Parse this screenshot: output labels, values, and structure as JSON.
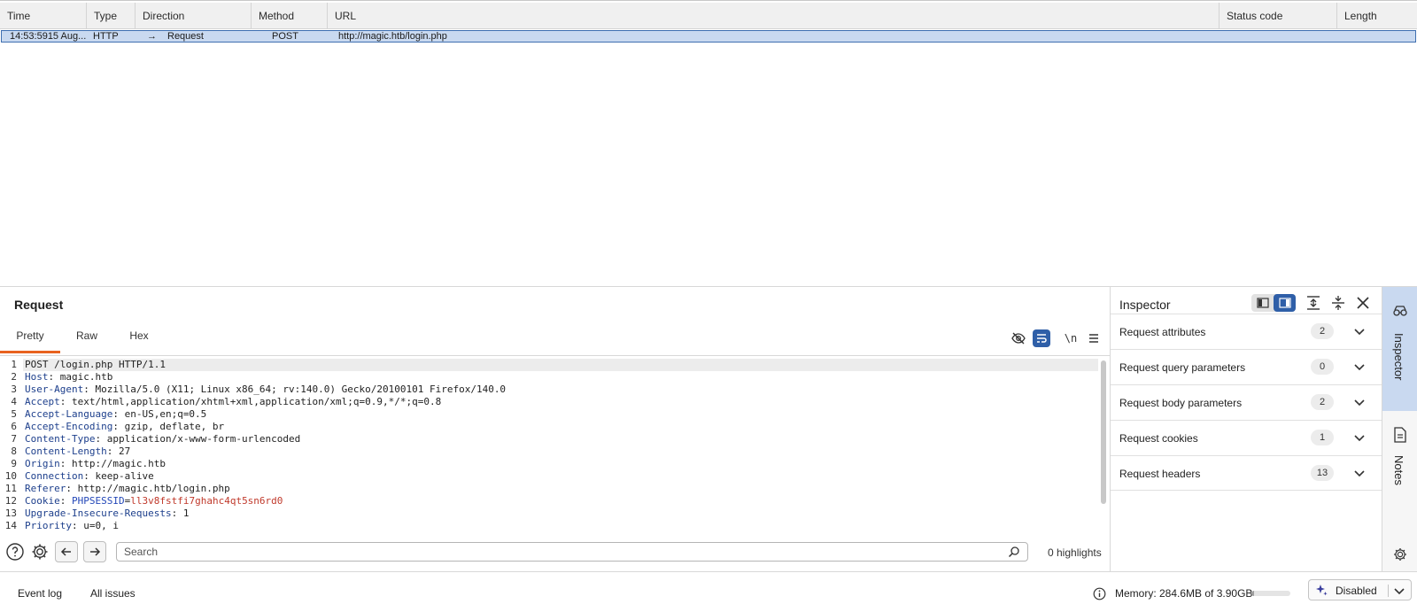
{
  "history": {
    "columns": [
      "Time",
      "Type",
      "Direction",
      "Method",
      "URL",
      "Status code",
      "Length"
    ],
    "rows": [
      {
        "time": "14:53:5915 Aug...",
        "type": "HTTP",
        "direction_arrow": "→",
        "direction": "Request",
        "method": "POST",
        "url": "http://magic.htb/login.php",
        "status": "",
        "length": ""
      }
    ]
  },
  "request": {
    "title": "Request",
    "tabs": [
      "Pretty",
      "Raw",
      "Hex"
    ],
    "active_tab": "Pretty",
    "newline_toggle": "\\n",
    "lines": [
      {
        "n": "1",
        "parts": [
          {
            "t": "POST /login.php HTTP/1.1",
            "c": "plain"
          }
        ]
      },
      {
        "n": "2",
        "parts": [
          {
            "t": "Host",
            "c": "hk"
          },
          {
            "t": ": magic.htb",
            "c": "plain"
          }
        ]
      },
      {
        "n": "3",
        "parts": [
          {
            "t": "User-Agent",
            "c": "hk"
          },
          {
            "t": ": Mozilla/5.0 (X11; Linux x86_64; rv:140.0) Gecko/20100101 Firefox/140.0",
            "c": "plain"
          }
        ]
      },
      {
        "n": "4",
        "parts": [
          {
            "t": "Accept",
            "c": "hk"
          },
          {
            "t": ": text/html,application/xhtml+xml,application/xml;q=0.9,*/*;q=0.8",
            "c": "plain"
          }
        ]
      },
      {
        "n": "5",
        "parts": [
          {
            "t": "Accept-Language",
            "c": "hk"
          },
          {
            "t": ": en-US,en;q=0.5",
            "c": "plain"
          }
        ]
      },
      {
        "n": "6",
        "parts": [
          {
            "t": "Accept-Encoding",
            "c": "hk"
          },
          {
            "t": ": gzip, deflate, br",
            "c": "plain"
          }
        ]
      },
      {
        "n": "7",
        "parts": [
          {
            "t": "Content-Type",
            "c": "hk"
          },
          {
            "t": ": application/x-www-form-urlencoded",
            "c": "plain"
          }
        ]
      },
      {
        "n": "8",
        "parts": [
          {
            "t": "Content-Length",
            "c": "hk"
          },
          {
            "t": ": 27",
            "c": "plain"
          }
        ]
      },
      {
        "n": "9",
        "parts": [
          {
            "t": "Origin",
            "c": "hk"
          },
          {
            "t": ": http://magic.htb",
            "c": "plain"
          }
        ]
      },
      {
        "n": "10",
        "parts": [
          {
            "t": "Connection",
            "c": "hk"
          },
          {
            "t": ": keep-alive",
            "c": "plain"
          }
        ]
      },
      {
        "n": "11",
        "parts": [
          {
            "t": "Referer",
            "c": "hk"
          },
          {
            "t": ": http://magic.htb/login.php",
            "c": "plain"
          }
        ]
      },
      {
        "n": "12",
        "parts": [
          {
            "t": "Cookie",
            "c": "hk"
          },
          {
            "t": ": ",
            "c": "plain"
          },
          {
            "t": "PHPSESSID",
            "c": "ck"
          },
          {
            "t": "=",
            "c": "plain"
          },
          {
            "t": "ll3v8fstfi7ghahc4qt5sn6rd0",
            "c": "cv"
          }
        ]
      },
      {
        "n": "13",
        "parts": [
          {
            "t": "Upgrade-Insecure-Requests",
            "c": "hk"
          },
          {
            "t": ": 1",
            "c": "plain"
          }
        ]
      },
      {
        "n": "14",
        "parts": [
          {
            "t": "Priority",
            "c": "hk"
          },
          {
            "t": ": u=0, i",
            "c": "plain"
          }
        ]
      }
    ]
  },
  "search": {
    "placeholder": "Search",
    "highlights": "0 highlights"
  },
  "inspector": {
    "title": "Inspector",
    "sections": [
      {
        "label": "Request attributes",
        "count": "2"
      },
      {
        "label": "Request query parameters",
        "count": "0"
      },
      {
        "label": "Request body parameters",
        "count": "2"
      },
      {
        "label": "Request cookies",
        "count": "1"
      },
      {
        "label": "Request headers",
        "count": "13"
      }
    ]
  },
  "sidebar": {
    "inspector_label": "Inspector",
    "notes_label": "Notes"
  },
  "statusbar": {
    "event_log": "Event log",
    "all_issues": "All issues",
    "memory": "Memory: 284.6MB of 3.90GB",
    "memory_fraction": 0.07,
    "ai_label": "Disabled"
  },
  "colors": {
    "accent_tab": "#e8621f",
    "selection": "#c9d9f0",
    "header_key": "#1d3f8c",
    "cookie_value": "#c0392b"
  }
}
